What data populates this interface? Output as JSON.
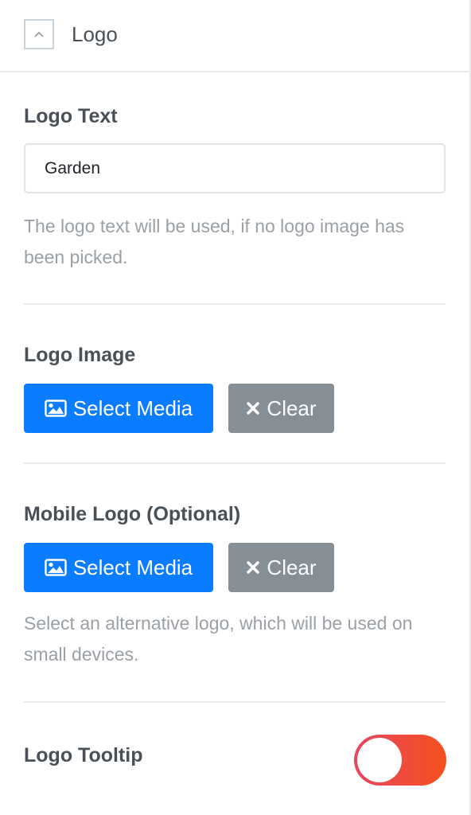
{
  "panel": {
    "title": "Logo"
  },
  "logo_text": {
    "label": "Logo Text",
    "value": "Garden",
    "help": "The logo text will be used, if no logo image has been picked."
  },
  "logo_image": {
    "label": "Logo Image",
    "select_label": "Select Media",
    "clear_label": "Clear"
  },
  "mobile_logo": {
    "label": "Mobile Logo (Optional)",
    "select_label": "Select Media",
    "clear_label": "Clear",
    "help": "Select an alternative logo, which will be used on small devices."
  },
  "logo_tooltip": {
    "label": "Logo Tooltip",
    "enabled": false
  },
  "icons": {
    "collapse": "chevron-up-icon",
    "media": "image-icon",
    "clear": "times-icon"
  },
  "colors": {
    "primary": "#0a7cff",
    "secondary": "#868e96",
    "toggle_start": "#e94560",
    "toggle_end": "#f4511e"
  }
}
